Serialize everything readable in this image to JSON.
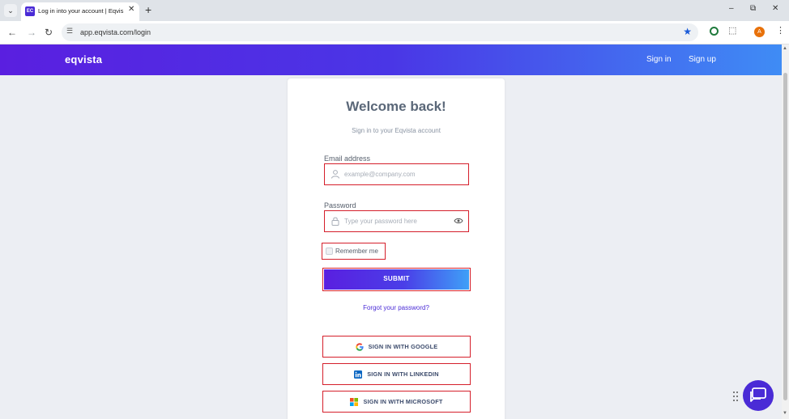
{
  "browser": {
    "tab_menu_icon": "chevron-down-icon",
    "tab_title": "Log in into your account | Eqvis",
    "tab_favicon_text": "EC",
    "new_tab_icon": "+",
    "url": "app.eqvista.com/login",
    "profile_initial": "A"
  },
  "header": {
    "logo": "eqvista",
    "nav": {
      "sign_in": "Sign in",
      "sign_up": "Sign up"
    }
  },
  "login": {
    "title": "Welcome back!",
    "subtitle": "Sign in to your Eqvista account",
    "email": {
      "label": "Email address",
      "placeholder": "example@company.com",
      "value": ""
    },
    "password": {
      "label": "Password",
      "placeholder": "Type your password here",
      "value": ""
    },
    "remember_label": "Remember me",
    "remember_checked": false,
    "submit_label": "SUBMIT",
    "forgot_label": "Forgot your password?",
    "social": [
      {
        "label": "SIGN IN WITH GOOGLE",
        "icon": "google-icon"
      },
      {
        "label": "SIGN IN WITH LINKEDIN",
        "icon": "linkedin-icon"
      },
      {
        "label": "SIGN IN WITH MICROSOFT",
        "icon": "microsoft-icon"
      }
    ]
  },
  "colors": {
    "brand_purple": "#5a1fe0",
    "brand_blue": "#3f8cf5",
    "highlight_red": "#d51f2b",
    "link": "#4a2bd6"
  }
}
